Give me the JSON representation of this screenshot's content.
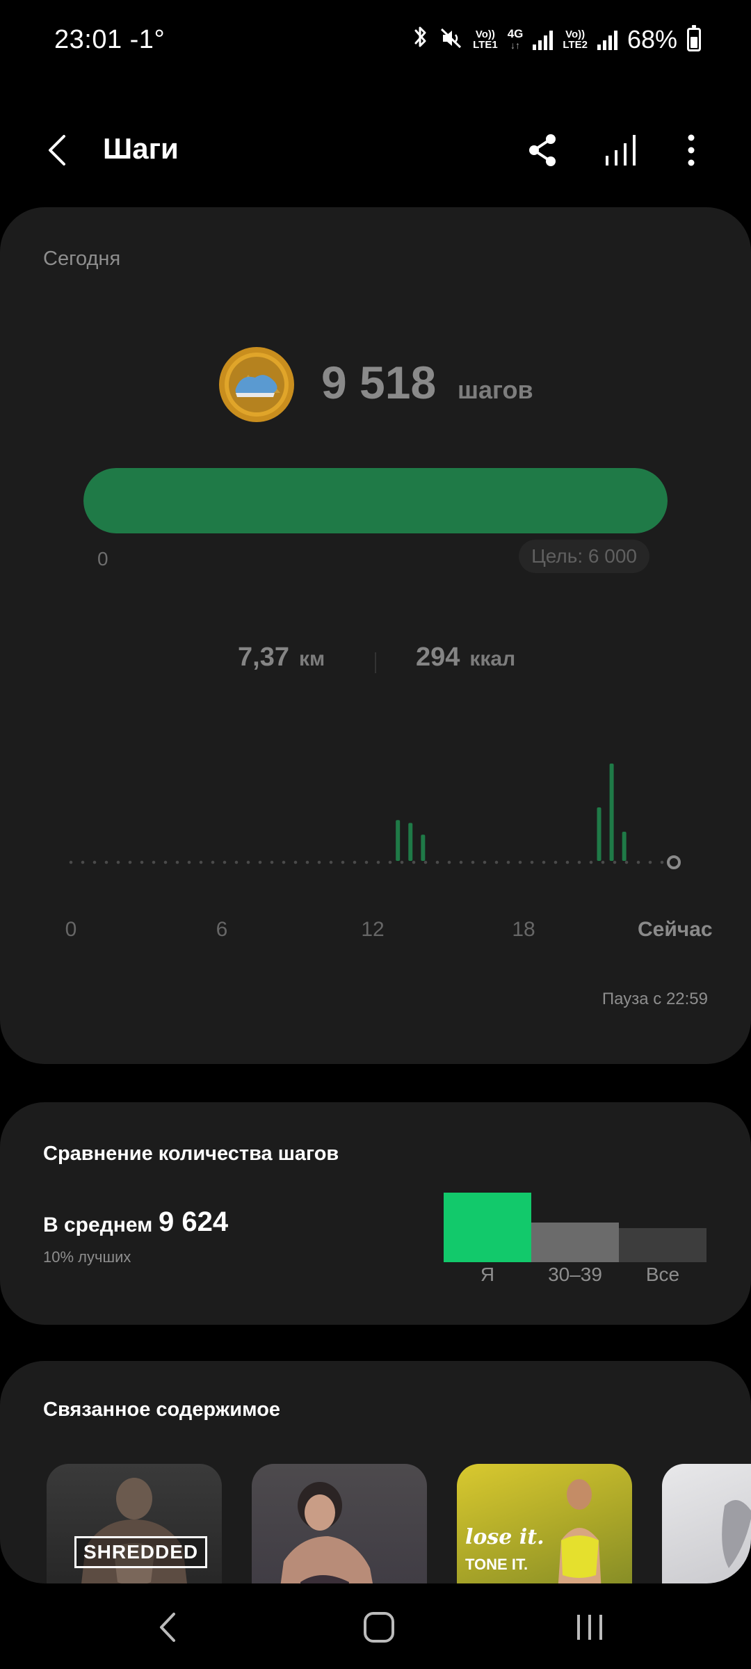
{
  "status": {
    "time": "23:01",
    "temperature": "-1°",
    "sim1": {
      "top": "Vo))",
      "bottom": "LTE1"
    },
    "network": {
      "top": "4G",
      "bottom": "↓↑"
    },
    "sim2": {
      "top": "Vo))",
      "bottom": "LTE2"
    },
    "battery": "68%",
    "battery_fraction": 0.68
  },
  "header": {
    "title": "Шаги"
  },
  "today": {
    "label": "Сегодня",
    "steps": "9 518",
    "steps_unit": "шагов",
    "progress": {
      "min": "0",
      "goal": "Цель: 6 000",
      "fraction": 1.0
    },
    "distance": {
      "value": "7,37",
      "unit": "км"
    },
    "calories": {
      "value": "294",
      "unit": "ккал"
    },
    "pause": "Пауза с 22:59"
  },
  "chart_data": {
    "type": "bar",
    "x_ticks": [
      "0",
      "6",
      "12",
      "18"
    ],
    "now_label": "Сейчас",
    "xlim": [
      0,
      24
    ],
    "ylim": [
      0,
      1
    ],
    "bars": [
      {
        "x": 13.0,
        "value": 0.42
      },
      {
        "x": 13.5,
        "value": 0.39
      },
      {
        "x": 14.0,
        "value": 0.27
      },
      {
        "x": 21.0,
        "value": 0.55
      },
      {
        "x": 21.5,
        "value": 1.0
      },
      {
        "x": 22.0,
        "value": 0.3
      }
    ],
    "colors": {
      "bar": "#1f7a47",
      "dots": "#4a4a4a"
    }
  },
  "compare": {
    "title": "Сравнение количества шагов",
    "avg_label": "В среднем",
    "avg_value": "9 624",
    "better_text": "10% лучших",
    "categories": [
      "Я",
      "30–39",
      "Все"
    ],
    "values": [
      1.0,
      0.57,
      0.49
    ],
    "colors": [
      "#12c96b",
      "#6b6b6b",
      "#3d3d3d"
    ]
  },
  "related": {
    "title": "Связанное содержимое",
    "items": [
      {
        "badge": "SHREDDED"
      },
      {},
      {
        "tag1": "lose it.",
        "tag2": "TONE IT."
      },
      {}
    ]
  }
}
